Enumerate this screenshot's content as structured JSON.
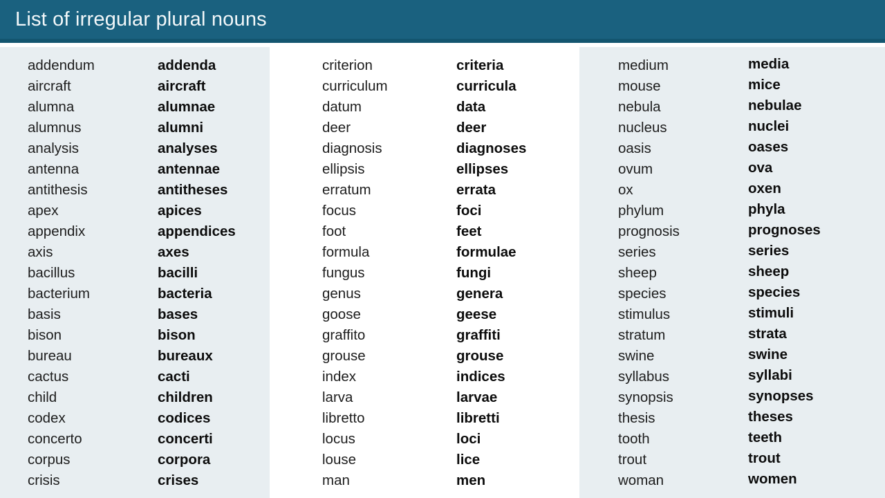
{
  "header": {
    "title": "List of irregular plural nouns",
    "bar_color": "#1a617f",
    "underline_color": "#13556f",
    "title_color": "#f2f7f9"
  },
  "colors": {
    "panel_tinted_background": "#e8eef1",
    "panel_white_background": "#ffffff",
    "text": "#1d1d1d"
  },
  "panels": [
    {
      "name": "panel-a-to-c",
      "background": "#e8eef1",
      "singular": [
        "addendum",
        "aircraft",
        "alumna",
        "alumnus",
        "analysis",
        "antenna",
        "antithesis",
        "apex",
        "appendix",
        "axis",
        "bacillus",
        "bacterium",
        "basis",
        "bison",
        "bureau",
        "cactus",
        "child",
        "codex",
        "concerto",
        "corpus",
        "crisis"
      ],
      "plural": [
        "addenda",
        "aircraft",
        "alumnae",
        "alumni",
        "analyses",
        "antennae",
        "antitheses",
        "apices",
        "appendices",
        "axes",
        "bacilli",
        "bacteria",
        "bases",
        "bison",
        "bureaux",
        "cacti",
        "children",
        "codices",
        "concerti",
        "corpora",
        "crises"
      ]
    },
    {
      "name": "panel-c-to-m",
      "background": "#ffffff",
      "singular": [
        "criterion",
        "curriculum",
        "datum",
        "deer",
        "diagnosis",
        "ellipsis",
        "erratum",
        "focus",
        "foot",
        "formula",
        "fungus",
        "genus",
        "goose",
        "graffito",
        "grouse",
        "index",
        "larva",
        "libretto",
        "locus",
        "louse",
        "man"
      ],
      "plural": [
        "criteria",
        "curricula",
        "data",
        "deer",
        "diagnoses",
        "ellipses",
        "errata",
        "foci",
        "feet",
        "formulae",
        "fungi",
        "genera",
        "geese",
        "graffiti",
        "grouse",
        "indices",
        "larvae",
        "libretti",
        "loci",
        "lice",
        "men"
      ]
    },
    {
      "name": "panel-m-to-w",
      "background": "#e8eef1",
      "singular": [
        "medium",
        "mouse",
        "nebula",
        "nucleus",
        "oasis",
        "ovum",
        "ox",
        "phylum",
        "prognosis",
        "series",
        "sheep",
        "species",
        "stimulus",
        "stratum",
        "swine",
        "syllabus",
        "synopsis",
        "thesis",
        "tooth",
        "trout",
        "woman"
      ],
      "plural": [
        "media",
        "mice",
        "nebulae",
        "nuclei",
        "oases",
        "ova",
        "oxen",
        "phyla",
        "prognoses",
        "series",
        "sheep",
        "species",
        "stimuli",
        "strata",
        "swine",
        "syllabi",
        "synopses",
        "theses",
        "teeth",
        "trout",
        "women"
      ]
    }
  ]
}
